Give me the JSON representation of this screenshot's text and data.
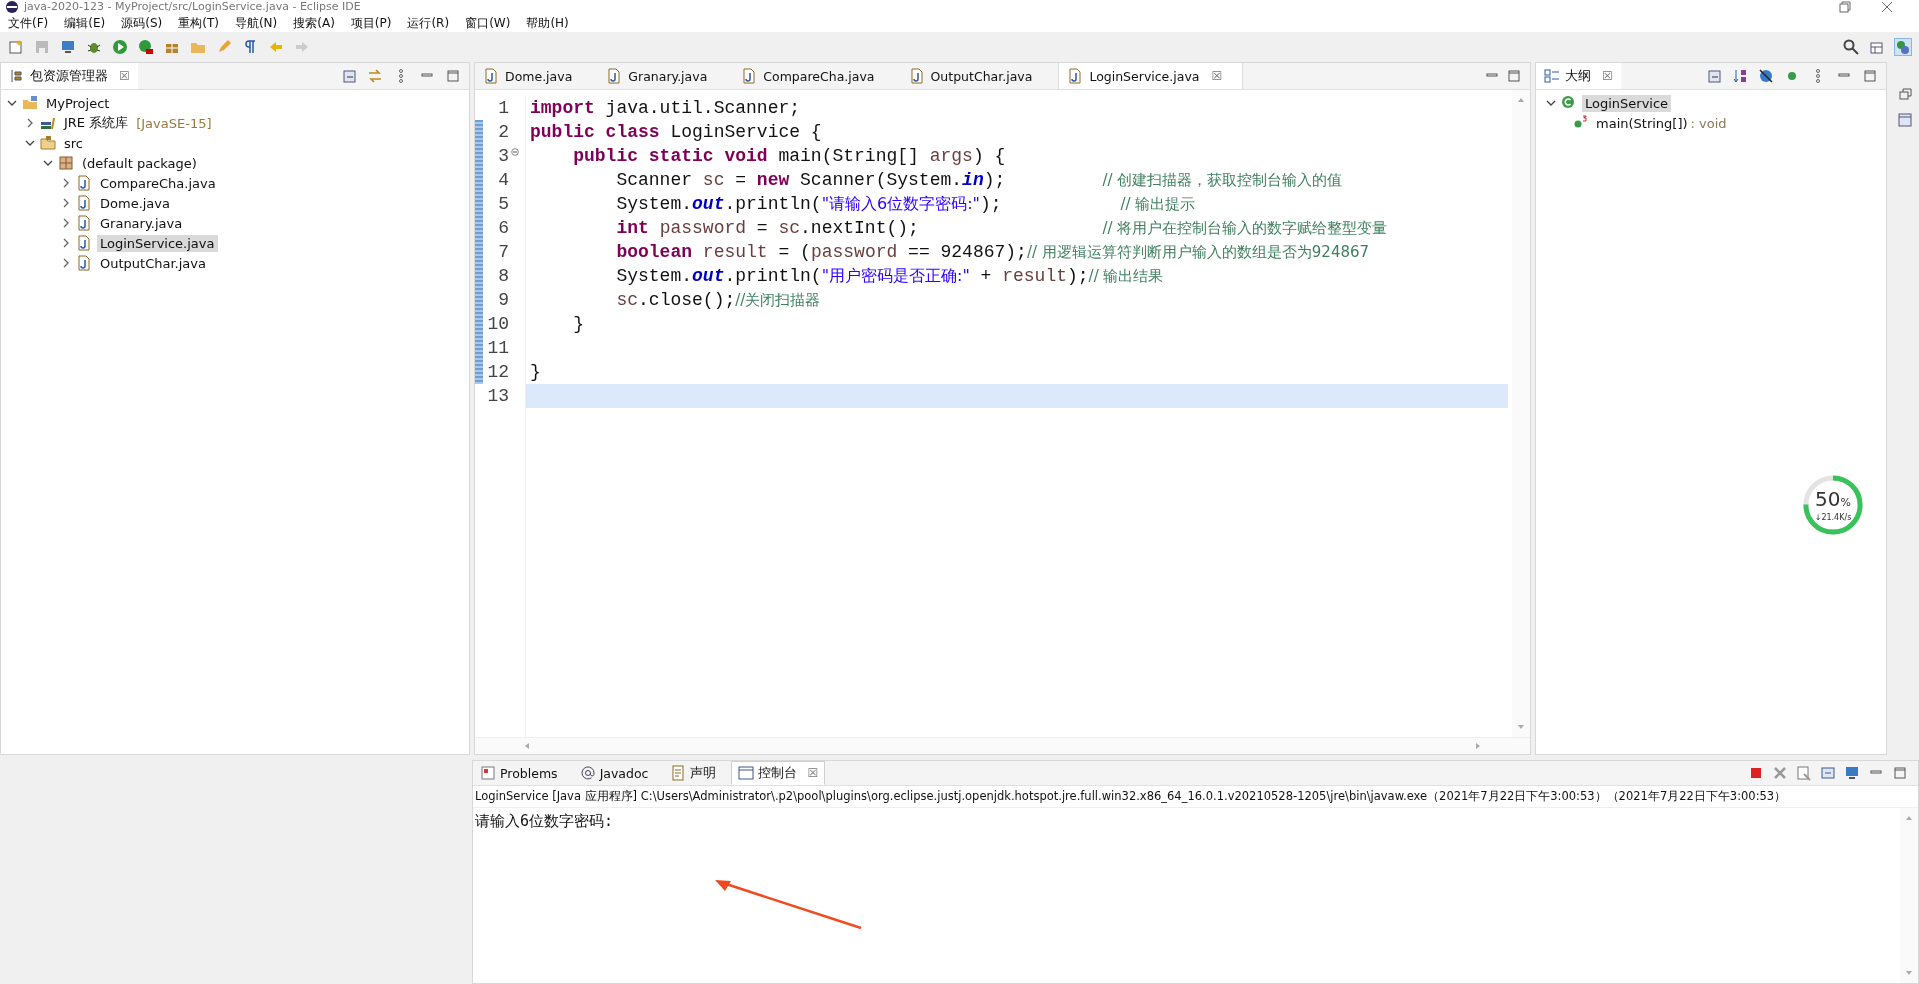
{
  "window": {
    "title": "java-2020-123 - MyProject/src/LoginService.java - Eclipse IDE"
  },
  "menu": [
    "文件(F)",
    "编辑(E)",
    "源码(S)",
    "重构(T)",
    "导航(N)",
    "搜索(A)",
    "项目(P)",
    "运行(R)",
    "窗口(W)",
    "帮助(H)"
  ],
  "explorer": {
    "title": "包资源管理器",
    "close": "☒",
    "tree": [
      {
        "kind": "project",
        "label": "MyProject",
        "expanded": true,
        "selected": false,
        "children": [
          {
            "kind": "library",
            "label": "JRE 系统库",
            "decoration": "[JavaSE-15]",
            "expanded": false,
            "selected": false
          },
          {
            "kind": "folder",
            "label": "src",
            "expanded": true,
            "selected": false,
            "children": [
              {
                "kind": "package",
                "label": "(default package)",
                "expanded": true,
                "selected": false,
                "children": [
                  {
                    "kind": "java",
                    "label": "CompareCha.java",
                    "expanded": false,
                    "selected": false
                  },
                  {
                    "kind": "java",
                    "label": "Dome.java",
                    "expanded": false,
                    "selected": false
                  },
                  {
                    "kind": "java",
                    "label": "Granary.java",
                    "expanded": false,
                    "selected": false
                  },
                  {
                    "kind": "java",
                    "label": "LoginService.java",
                    "expanded": false,
                    "selected": true
                  },
                  {
                    "kind": "java",
                    "label": "OutputChar.java",
                    "expanded": false,
                    "selected": false
                  }
                ]
              }
            ]
          }
        ]
      }
    ]
  },
  "editor": {
    "tabs": [
      {
        "label": "Dome.java",
        "selected": false
      },
      {
        "label": "Granary.java",
        "selected": false
      },
      {
        "label": "CompareCha.java",
        "selected": false
      },
      {
        "label": "OutputChar.java",
        "selected": false
      },
      {
        "label": "LoginService.java",
        "selected": true,
        "close": "☒"
      }
    ],
    "lines": [
      {
        "number": "1",
        "changed": false,
        "fold": false,
        "current": false,
        "tokens": [
          {
            "kind": "kw",
            "text": "import"
          },
          {
            "kind": "plain",
            "text": " java.util.Scanner;"
          }
        ]
      },
      {
        "number": "2",
        "changed": true,
        "fold": false,
        "current": false,
        "tokens": [
          {
            "kind": "kw",
            "text": "public class"
          },
          {
            "kind": "plain",
            "text": " LoginService {"
          }
        ]
      },
      {
        "number": "3",
        "changed": true,
        "fold": true,
        "current": false,
        "tokens": [
          {
            "kind": "kw",
            "text": "    public static void"
          },
          {
            "kind": "plain",
            "text": " main(String[] "
          },
          {
            "kind": "var",
            "text": "args"
          },
          {
            "kind": "plain",
            "text": ") {"
          }
        ]
      },
      {
        "number": "4",
        "changed": true,
        "fold": false,
        "current": false,
        "tokens": [
          {
            "kind": "plain",
            "text": "        Scanner "
          },
          {
            "kind": "var",
            "text": "sc"
          },
          {
            "kind": "plain",
            "text": " = "
          },
          {
            "kind": "kw",
            "text": "new"
          },
          {
            "kind": "plain",
            "text": " Scanner(System."
          },
          {
            "kind": "field",
            "text": "in"
          },
          {
            "kind": "plain",
            "text": ");         "
          },
          {
            "kind": "com",
            "text": "// 创建扫描器，获取控制台输入的值"
          }
        ]
      },
      {
        "number": "5",
        "changed": true,
        "fold": false,
        "current": false,
        "tokens": [
          {
            "kind": "plain",
            "text": "        System."
          },
          {
            "kind": "field",
            "text": "out"
          },
          {
            "kind": "plain",
            "text": ".println("
          },
          {
            "kind": "str",
            "text": "\"请输入6位数字密码:\""
          },
          {
            "kind": "plain",
            "text": ");           "
          },
          {
            "kind": "com",
            "text": "// 输出提示"
          }
        ]
      },
      {
        "number": "6",
        "changed": true,
        "fold": false,
        "current": false,
        "tokens": [
          {
            "kind": "kw",
            "text": "        int"
          },
          {
            "kind": "var",
            "text": " password"
          },
          {
            "kind": "plain",
            "text": " = "
          },
          {
            "kind": "var",
            "text": "sc"
          },
          {
            "kind": "plain",
            "text": ".nextInt();                 "
          },
          {
            "kind": "com",
            "text": "// 将用户在控制台输入的数字赋给整型变量"
          }
        ]
      },
      {
        "number": "7",
        "changed": true,
        "fold": false,
        "current": false,
        "tokens": [
          {
            "kind": "kw",
            "text": "        boolean"
          },
          {
            "kind": "var",
            "text": " result"
          },
          {
            "kind": "plain",
            "text": " = ("
          },
          {
            "kind": "var",
            "text": "password"
          },
          {
            "kind": "plain",
            "text": " == 924867);"
          },
          {
            "kind": "com",
            "text": "// 用逻辑运算符判断用户输入的数组是否为924867"
          }
        ]
      },
      {
        "number": "8",
        "changed": true,
        "fold": false,
        "current": false,
        "tokens": [
          {
            "kind": "plain",
            "text": "        System."
          },
          {
            "kind": "field",
            "text": "out"
          },
          {
            "kind": "plain",
            "text": ".println("
          },
          {
            "kind": "str",
            "text": "\"用户密码是否正确:\""
          },
          {
            "kind": "plain",
            "text": " + "
          },
          {
            "kind": "var",
            "text": "result"
          },
          {
            "kind": "plain",
            "text": ");"
          },
          {
            "kind": "com",
            "text": "// 输出结果"
          }
        ]
      },
      {
        "number": "9",
        "changed": true,
        "fold": false,
        "current": false,
        "tokens": [
          {
            "kind": "var",
            "text": "        sc"
          },
          {
            "kind": "plain",
            "text": ".close();"
          },
          {
            "kind": "com",
            "text": "//关闭扫描器"
          }
        ]
      },
      {
        "number": "10",
        "changed": true,
        "fold": false,
        "current": false,
        "tokens": [
          {
            "kind": "plain",
            "text": "    }"
          }
        ]
      },
      {
        "number": "11",
        "changed": true,
        "fold": false,
        "current": false
      },
      {
        "number": "12",
        "changed": true,
        "fold": false,
        "current": false,
        "tokens": [
          {
            "kind": "plain",
            "text": "}"
          }
        ]
      },
      {
        "number": "13",
        "changed": false,
        "fold": false,
        "current": true
      }
    ]
  },
  "outline": {
    "title": "大纲",
    "close": "☒",
    "items": [
      {
        "kind": "class",
        "label": "LoginService",
        "expanded": true,
        "selected": true,
        "children": [
          {
            "kind": "method",
            "label": "main(String[])",
            "type": " : void",
            "selected": false
          }
        ]
      }
    ]
  },
  "console": {
    "tabs": [
      {
        "kind": "problems",
        "label": "Problems",
        "selected": false
      },
      {
        "kind": "javadoc",
        "label": "Javadoc",
        "selected": false
      },
      {
        "kind": "declaration",
        "label": "声明",
        "selected": false
      },
      {
        "kind": "console",
        "label": "控制台",
        "selected": true,
        "close": "☒"
      }
    ],
    "description": "LoginService [Java 应用程序] C:\\Users\\Administrator\\.p2\\pool\\plugins\\org.eclipse.justj.openjdk.hotspot.jre.full.win32.x86_64_16.0.1.v20210528-1205\\jre\\bin\\javaw.exe（2021年7月22日下午3:00:53）（2021年7月22日下午3:00:53）",
    "output": [
      "请输入6位数字密码:"
    ]
  },
  "speed_widget": {
    "percent": "50",
    "unit": "%",
    "rate": "↓21.4K/s",
    "level": 0.75
  }
}
